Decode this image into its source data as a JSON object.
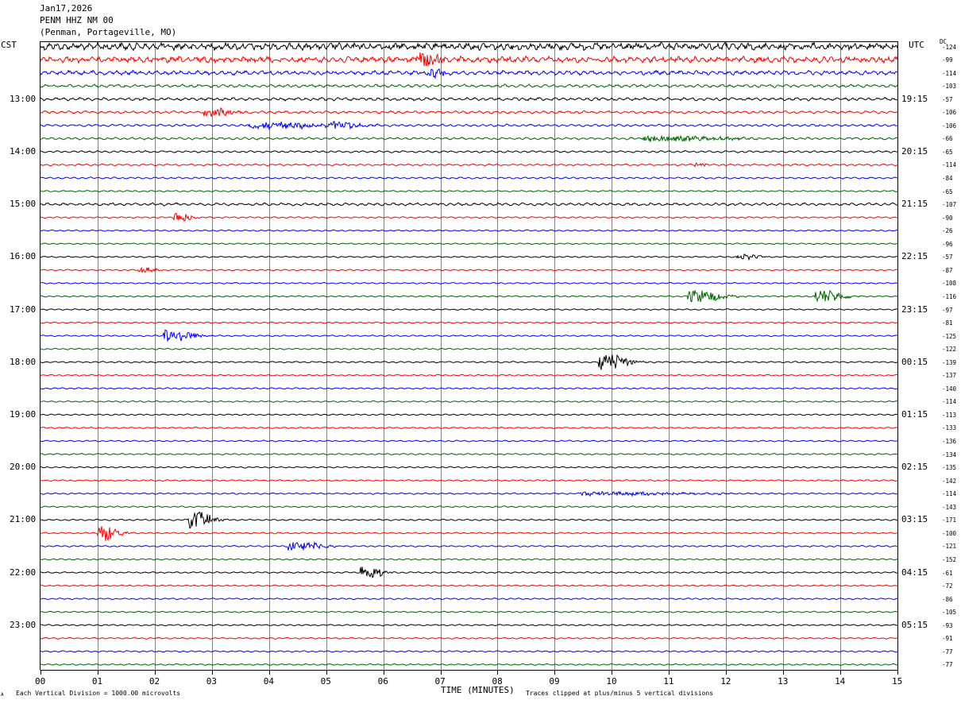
{
  "header": {
    "date": "Jan17,2026",
    "station": "PENM HHZ NM 00",
    "location": "(Penman, Portageville, MO)"
  },
  "labels": {
    "left_zone": "CST",
    "right_zone": "UTC",
    "dc": "DC",
    "xlabel": "TIME (MINUTES)",
    "footer_left": "Each Vertical Division = 1000.00 microvolts",
    "footer_right": "Traces clipped at plus/minus 5 vertical divisions",
    "corner_mark": "A"
  },
  "colors": {
    "trace_cycle": [
      "#000000",
      "#ff0000",
      "#0000ff",
      "#006400"
    ],
    "grid": "#808080",
    "frame": "#000000"
  },
  "chart_data": {
    "type": "line",
    "xlim": [
      0,
      15
    ],
    "x_ticks": [
      "00",
      "01",
      "02",
      "03",
      "04",
      "05",
      "06",
      "07",
      "08",
      "09",
      "10",
      "11",
      "12",
      "13",
      "14",
      "15"
    ],
    "trace_count": 48,
    "left_hour_labels": [
      "13:00",
      "14:00",
      "15:00",
      "16:00",
      "17:00",
      "18:00",
      "19:00",
      "20:00",
      "21:00",
      "22:00",
      "23:00"
    ],
    "right_hour_labels": [
      "19:15",
      "20:15",
      "21:15",
      "22:15",
      "23:15",
      "00:15",
      "01:15",
      "02:15",
      "03:15",
      "04:15",
      "05:15"
    ],
    "dc_offsets": [
      "-124",
      "-99",
      "-114",
      "-103",
      "-57",
      "-106",
      "-106",
      "-66",
      "-65",
      "-114",
      "-84",
      "-65",
      "-107",
      "-90",
      "-26",
      "-96",
      "-57",
      "-87",
      "-108",
      "-116",
      "-97",
      "-81",
      "-125",
      "-122",
      "-139",
      "-137",
      "-140",
      "-114",
      "-113",
      "-133",
      "-136",
      "-134",
      "-135",
      "-142",
      "-114",
      "-143",
      "-171",
      "-100",
      "-121",
      "-152",
      "-61",
      "-72",
      "-86",
      "-105",
      "-93",
      "-91",
      "-77",
      "-77"
    ],
    "trace_noise": [
      1.0,
      0.9,
      0.7,
      0.55,
      0.55,
      0.5,
      0.45,
      0.45,
      0.4,
      0.35,
      0.35,
      0.3,
      0.5,
      0.3,
      0.28,
      0.28,
      0.28,
      0.28,
      0.28,
      0.3,
      0.28,
      0.28,
      0.3,
      0.3,
      0.3,
      0.3,
      0.3,
      0.3,
      0.3,
      0.3,
      0.3,
      0.3,
      0.3,
      0.3,
      0.3,
      0.3,
      0.3,
      0.3,
      0.3,
      0.3,
      0.3,
      0.3,
      0.3,
      0.3,
      0.3,
      0.3,
      0.3,
      0.3
    ],
    "events": [
      {
        "trace": 1,
        "minute": 6.7,
        "amplitude": 1.0,
        "duration": 0.4
      },
      {
        "trace": 2,
        "minute": 6.9,
        "amplitude": 0.6,
        "duration": 0.3
      },
      {
        "trace": 5,
        "minute": 3.0,
        "amplitude": 0.7,
        "duration": 0.5
      },
      {
        "trace": 6,
        "minute": 4.0,
        "amplitude": 0.5,
        "duration": 1.2
      },
      {
        "trace": 6,
        "minute": 5.2,
        "amplitude": 0.6,
        "duration": 0.6
      },
      {
        "trace": 7,
        "minute": 11.0,
        "amplitude": 0.4,
        "duration": 1.5
      },
      {
        "trace": 9,
        "minute": 11.5,
        "amplitude": 0.5,
        "duration": 0.15
      },
      {
        "trace": 13,
        "minute": 2.4,
        "amplitude": 0.9,
        "duration": 0.3
      },
      {
        "trace": 16,
        "minute": 12.3,
        "amplitude": 0.4,
        "duration": 0.4
      },
      {
        "trace": 17,
        "minute": 1.8,
        "amplitude": 0.4,
        "duration": 0.3
      },
      {
        "trace": 19,
        "minute": 11.5,
        "amplitude": 1.0,
        "duration": 0.6
      },
      {
        "trace": 19,
        "minute": 13.7,
        "amplitude": 1.0,
        "duration": 0.5
      },
      {
        "trace": 22,
        "minute": 2.3,
        "amplitude": 1.1,
        "duration": 0.5
      },
      {
        "trace": 24,
        "minute": 9.9,
        "amplitude": 1.4,
        "duration": 0.5
      },
      {
        "trace": 34,
        "minute": 10.0,
        "amplitude": 0.3,
        "duration": 2.0
      },
      {
        "trace": 36,
        "minute": 2.7,
        "amplitude": 1.4,
        "duration": 0.4
      },
      {
        "trace": 37,
        "minute": 1.1,
        "amplitude": 1.3,
        "duration": 0.35
      },
      {
        "trace": 38,
        "minute": 4.5,
        "amplitude": 0.7,
        "duration": 0.6
      },
      {
        "trace": 40,
        "minute": 5.7,
        "amplitude": 1.2,
        "duration": 0.35
      }
    ]
  }
}
